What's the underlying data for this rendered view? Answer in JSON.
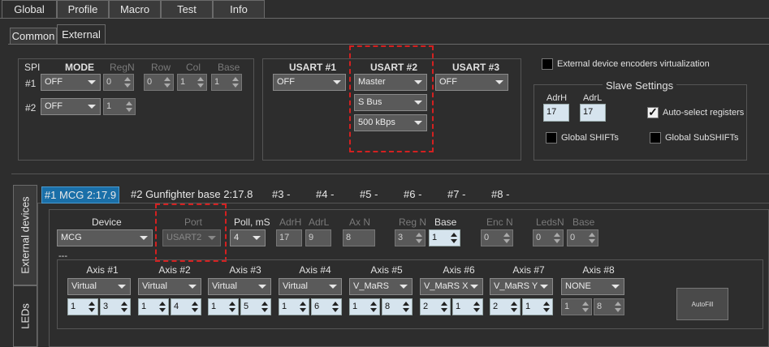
{
  "top_tabs": [
    "Global",
    "Profile",
    "Macro",
    "Test",
    "Info"
  ],
  "sub_tabs": [
    "Common",
    "External"
  ],
  "spi": {
    "label": "SPI",
    "headers": [
      "MODE",
      "RegN",
      "Row",
      "Col",
      "Base"
    ],
    "rows": [
      {
        "label": "#1",
        "mode": "OFF",
        "regn": "0",
        "row": "0",
        "col": "1",
        "base": "1"
      },
      {
        "label": "#2",
        "mode": "OFF",
        "regn": "1"
      }
    ]
  },
  "usart": {
    "headers": [
      "USART #1",
      "USART #2",
      "USART #3"
    ],
    "u1": "OFF",
    "u2_mode": "Master",
    "u2_proto": "S Bus",
    "u2_speed": "500 kBps",
    "u3": "OFF"
  },
  "virt_label": "External device encoders virtualization",
  "slave": {
    "title": "Slave Settings",
    "adrh_label": "AdrH",
    "adrl_label": "AdrL",
    "adrh": "17",
    "adrl": "17",
    "auto": "Auto-select registers",
    "shifts": "Global SHIFTs",
    "subshifts": "Global SubSHIFTs",
    "check": "✓"
  },
  "side_tabs": [
    "External devices",
    "LEDs"
  ],
  "device_tabs": [
    "#1 MCG 2:17.9",
    "#2 Gunfighter base 2:17.8",
    "#3 -",
    "#4 -",
    "#5 -",
    "#6 -",
    "#7 -",
    "#8 -"
  ],
  "device": {
    "h_device": "Device",
    "h_port": "Port",
    "h_poll": "Poll, mS",
    "h_adrh": "AdrH",
    "h_adrl": "AdrL",
    "h_axn": "Ax N",
    "h_regn": "Reg N",
    "h_base": "Base",
    "h_encn": "Enc N",
    "h_ledsn": "LedsN",
    "h_base2": "Base",
    "device": "MCG",
    "port": "USART2",
    "poll": "4",
    "adrh": "17",
    "adrl": "9",
    "axn": "8",
    "regn": "3",
    "base": "1",
    "encn": "0",
    "ledsn": "0",
    "base2": "0"
  },
  "dashes": "---",
  "axes": [
    {
      "label": "Axis #1",
      "type": "Virtual",
      "a": "1",
      "b": "3"
    },
    {
      "label": "Axis #2",
      "type": "Virtual",
      "a": "1",
      "b": "4"
    },
    {
      "label": "Axis #3",
      "type": "Virtual",
      "a": "1",
      "b": "5"
    },
    {
      "label": "Axis #4",
      "type": "Virtual",
      "a": "1",
      "b": "6"
    },
    {
      "label": "Axis #5",
      "type": "V_MaRS",
      "a": "1",
      "b": "8"
    },
    {
      "label": "Axis #6",
      "type": "V_MaRS X",
      "a": "2",
      "b": "1"
    },
    {
      "label": "Axis #7",
      "type": "V_MaRS Y",
      "a": "2",
      "b": "1"
    },
    {
      "label": "Axis #8",
      "type": "NONE",
      "a": "1",
      "b": "8"
    }
  ],
  "autofill": "AutoFill",
  "colors": {
    "highlight": "#1a6fa8",
    "annotation": "#d42020"
  }
}
